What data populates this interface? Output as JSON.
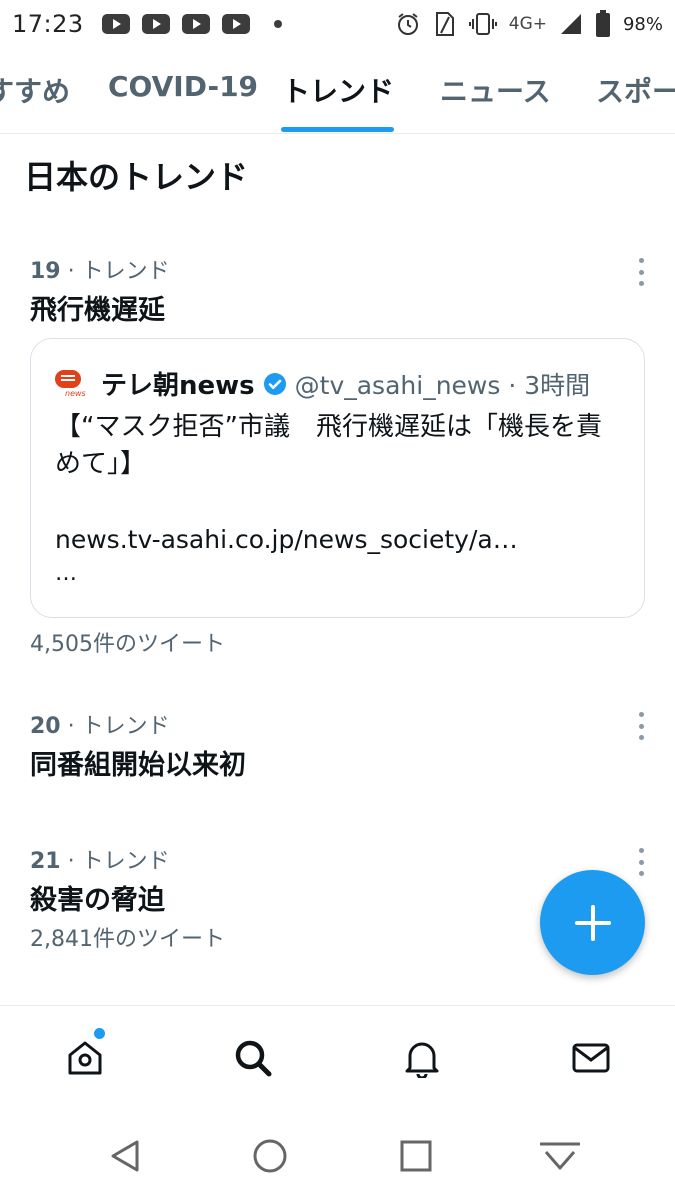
{
  "status_bar": {
    "time": "17:23",
    "network": "4G+",
    "battery": "98%"
  },
  "tabs": [
    {
      "label": "すすめ",
      "active": false
    },
    {
      "label": "COVID-19",
      "active": false
    },
    {
      "label": "トレンド",
      "active": true
    },
    {
      "label": "ニュース",
      "active": false
    },
    {
      "label": "スポー",
      "active": false
    }
  ],
  "section_title": "日本のトレンド",
  "trends": [
    {
      "rank": "19",
      "category": "· トレンド",
      "title": "飛行機遅延",
      "tweet": {
        "name": "テレ朝news",
        "handle_time": "@tv_asahi_news · 3時間",
        "text": "【“マスク拒否”市議　飛行機遅延は「機長を責めて」】",
        "link": "news.tv-asahi.co.jp/news_society/a…",
        "ellipsis": "…"
      },
      "count": "4,505件のツイート"
    },
    {
      "rank": "20",
      "category": "· トレンド",
      "title": "同番組開始以来初",
      "count": ""
    },
    {
      "rank": "21",
      "category": "· トレンド",
      "title": "殺害の脅迫",
      "count": "2,841件のツイート"
    }
  ],
  "colors": {
    "accent": "#1d9bf0",
    "text_primary": "#0f1419",
    "text_secondary": "#536471"
  },
  "bottom_nav": [
    "home-icon",
    "search-icon",
    "bell-icon",
    "mail-icon"
  ],
  "system_nav": [
    "back-icon",
    "home-circle-icon",
    "recents-icon",
    "hide-keyboard-icon"
  ]
}
